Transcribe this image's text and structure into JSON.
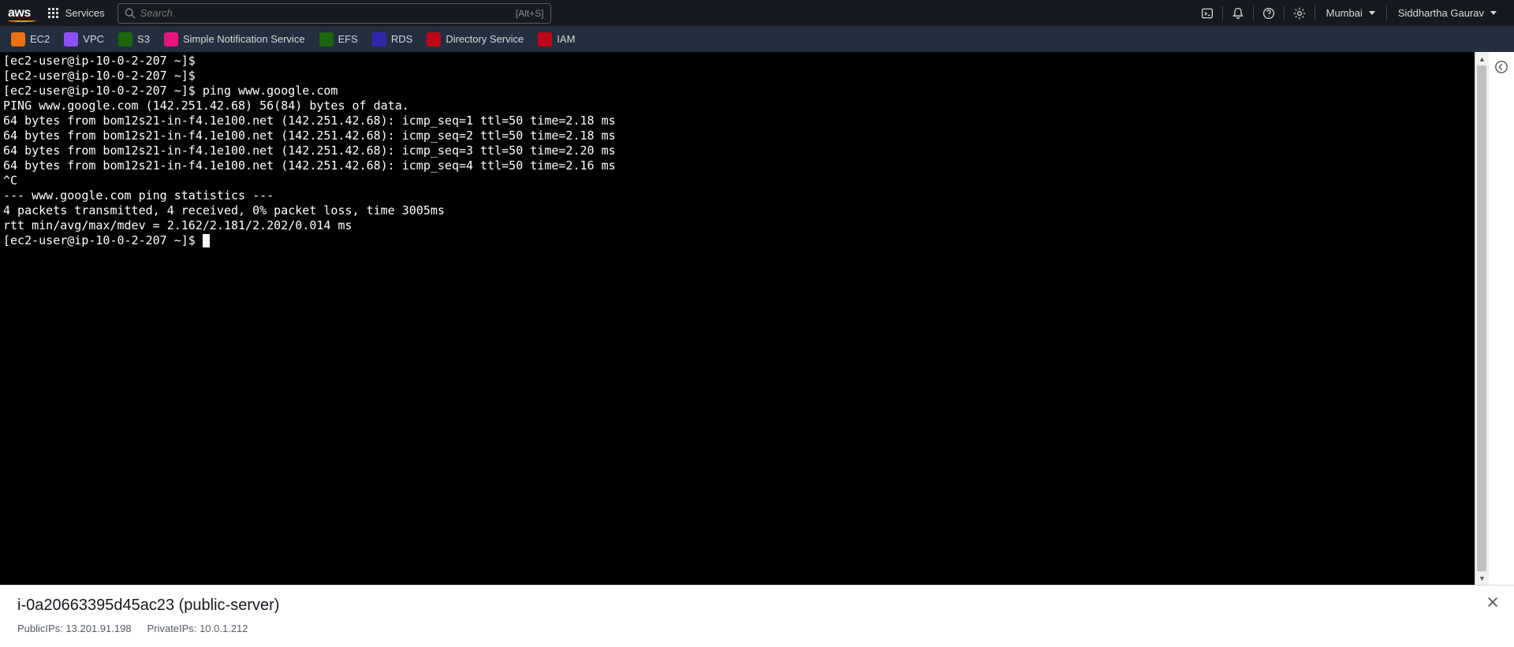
{
  "topnav": {
    "logo_text": "aws",
    "services_label": "Services",
    "search_placeholder": "Search",
    "search_shortcut": "[Alt+S]",
    "region_label": "Mumbai",
    "user_label": "Siddhartha Gaurav"
  },
  "favorites": [
    {
      "label": "EC2",
      "color": "#ec7211"
    },
    {
      "label": "VPC",
      "color": "#8c4fff"
    },
    {
      "label": "S3",
      "color": "#1b660f"
    },
    {
      "label": "Simple Notification Service",
      "color": "#e7157b"
    },
    {
      "label": "EFS",
      "color": "#1b660f"
    },
    {
      "label": "RDS",
      "color": "#2e27ad"
    },
    {
      "label": "Directory Service",
      "color": "#bf0816"
    },
    {
      "label": "IAM",
      "color": "#bf0816"
    }
  ],
  "terminal": {
    "lines": [
      "[ec2-user@ip-10-0-2-207 ~]$",
      "[ec2-user@ip-10-0-2-207 ~]$",
      "[ec2-user@ip-10-0-2-207 ~]$ ping www.google.com",
      "PING www.google.com (142.251.42.68) 56(84) bytes of data.",
      "64 bytes from bom12s21-in-f4.1e100.net (142.251.42.68): icmp_seq=1 ttl=50 time=2.18 ms",
      "64 bytes from bom12s21-in-f4.1e100.net (142.251.42.68): icmp_seq=2 ttl=50 time=2.18 ms",
      "64 bytes from bom12s21-in-f4.1e100.net (142.251.42.68): icmp_seq=3 ttl=50 time=2.20 ms",
      "64 bytes from bom12s21-in-f4.1e100.net (142.251.42.68): icmp_seq=4 ttl=50 time=2.16 ms",
      "^C",
      "--- www.google.com ping statistics ---",
      "4 packets transmitted, 4 received, 0% packet loss, time 3005ms",
      "rtt min/avg/max/mdev = 2.162/2.181/2.202/0.014 ms"
    ],
    "prompt": "[ec2-user@ip-10-0-2-207 ~]$ "
  },
  "footer": {
    "title": "i-0a20663395d45ac23 (public-server)",
    "public_ip_label": "PublicIPs:",
    "public_ip_value": "13.201.91.198",
    "private_ip_label": "PrivateIPs:",
    "private_ip_value": "10.0.1.212"
  }
}
